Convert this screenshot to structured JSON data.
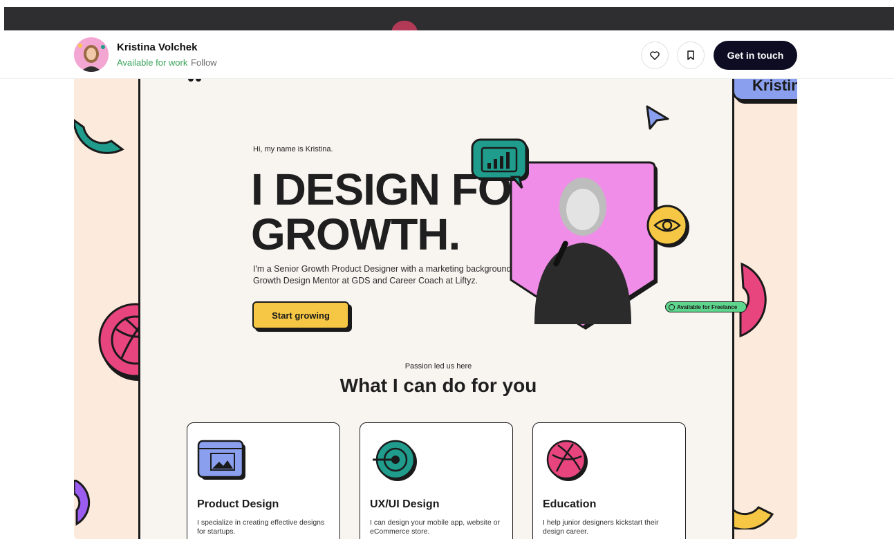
{
  "header": {
    "author_name": "Kristina Volchek",
    "status": "Available for work",
    "follow_label": "Follow",
    "cta_label": "Get in touch"
  },
  "hero": {
    "name_tag": "Kristina",
    "greeting": "Hi, my name is Kristina.",
    "headline_line1": "I DESIGN FOR",
    "headline_line2": "GROWTH.",
    "blurb": "I'm a Senior Growth Product Designer with a marketing background, Growth Design Mentor at GDS and Career Coach at Liftyz.",
    "start_label": "Start growing",
    "freelance_badge": "Available for Freelance"
  },
  "services": {
    "eyebrow": "Passion led us here",
    "title": "What I can do for you",
    "cards": [
      {
        "title": "Product Design",
        "desc": "I specialize in creating effective designs for startups."
      },
      {
        "title": "UX/UI Design",
        "desc": "I can design your mobile app, website or eCommerce store."
      },
      {
        "title": "Education",
        "desc": "I help junior designers kickstart their design career."
      }
    ]
  },
  "colors": {
    "accent_dark": "#0d0c22",
    "available_green": "#3aa35a",
    "yellow": "#f6c744",
    "pink": "#e8457f",
    "teal": "#1f9c8c",
    "violet": "#8aa0ef",
    "purple": "#9b5cf0"
  },
  "icons": {
    "like": "heart-icon",
    "save": "bookmark-icon"
  }
}
